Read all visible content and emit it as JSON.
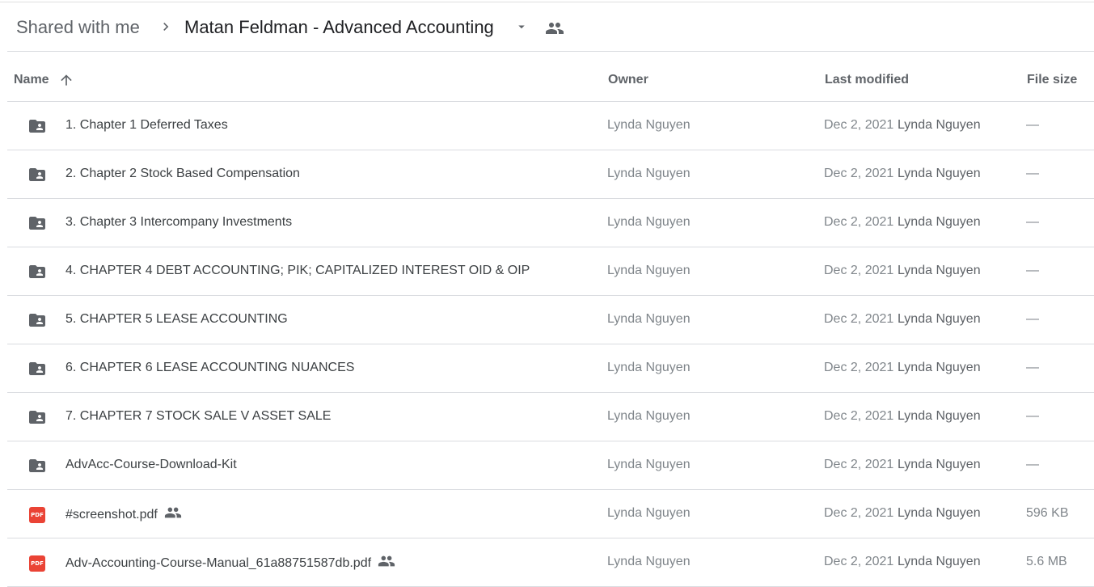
{
  "breadcrumb": {
    "root": "Shared with me",
    "current": "Matan Feldman - Advanced Accounting"
  },
  "columns": {
    "name": "Name",
    "owner": "Owner",
    "last_modified": "Last modified",
    "file_size": "File size"
  },
  "icons": {
    "separator": "chevron-right-icon",
    "dropdown": "arrow-drop-down-icon",
    "shared": "people-icon",
    "sort": "arrow-upward-icon",
    "folder": "shared-folder-icon",
    "pdf": "pdf-icon"
  },
  "colors": {
    "pdf": "#ea4335",
    "folder": "#5f6368"
  },
  "rows": [
    {
      "type": "folder",
      "name": "1. Chapter 1 Deferred Taxes",
      "owner": "Lynda Nguyen",
      "date": "Dec 2, 2021",
      "modifier": "Lynda Nguyen",
      "size": "—",
      "shared": false
    },
    {
      "type": "folder",
      "name": "2. Chapter 2 Stock Based Compensation",
      "owner": "Lynda Nguyen",
      "date": "Dec 2, 2021",
      "modifier": "Lynda Nguyen",
      "size": "—",
      "shared": false
    },
    {
      "type": "folder",
      "name": "3. Chapter 3 Intercompany Investments",
      "owner": "Lynda Nguyen",
      "date": "Dec 2, 2021",
      "modifier": "Lynda Nguyen",
      "size": "—",
      "shared": false
    },
    {
      "type": "folder",
      "name": "4. CHAPTER 4 DEBT ACCOUNTING; PIK; CAPITALIZED INTEREST OID & OIP",
      "owner": "Lynda Nguyen",
      "date": "Dec 2, 2021",
      "modifier": "Lynda Nguyen",
      "size": "—",
      "shared": false
    },
    {
      "type": "folder",
      "name": "5. CHAPTER 5 LEASE ACCOUNTING",
      "owner": "Lynda Nguyen",
      "date": "Dec 2, 2021",
      "modifier": "Lynda Nguyen",
      "size": "—",
      "shared": false
    },
    {
      "type": "folder",
      "name": "6. CHAPTER 6 LEASE ACCOUNTING NUANCES",
      "owner": "Lynda Nguyen",
      "date": "Dec 2, 2021",
      "modifier": "Lynda Nguyen",
      "size": "—",
      "shared": false
    },
    {
      "type": "folder",
      "name": "7. CHAPTER 7 STOCK SALE V ASSET SALE",
      "owner": "Lynda Nguyen",
      "date": "Dec 2, 2021",
      "modifier": "Lynda Nguyen",
      "size": "—",
      "shared": false
    },
    {
      "type": "folder",
      "name": "AdvAcc-Course-Download-Kit",
      "owner": "Lynda Nguyen",
      "date": "Dec 2, 2021",
      "modifier": "Lynda Nguyen",
      "size": "—",
      "shared": false
    },
    {
      "type": "pdf",
      "name": "#screenshot.pdf",
      "owner": "Lynda Nguyen",
      "date": "Dec 2, 2021",
      "modifier": "Lynda Nguyen",
      "size": "596 KB",
      "shared": true,
      "badge": "PDF"
    },
    {
      "type": "pdf",
      "name": "Adv-Accounting-Course-Manual_61a88751587db.pdf",
      "owner": "Lynda Nguyen",
      "date": "Dec 2, 2021",
      "modifier": "Lynda Nguyen",
      "size": "5.6 MB",
      "shared": true,
      "badge": "PDF"
    }
  ]
}
